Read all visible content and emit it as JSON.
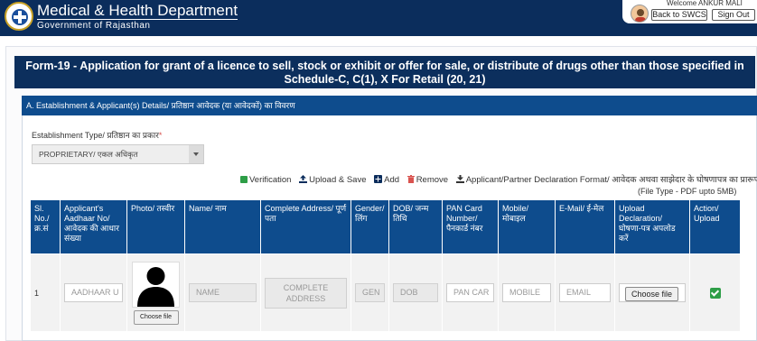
{
  "header": {
    "title": "Medical & Health Department",
    "subtitle": "Government of Rajasthan",
    "welcome": "Welcome ANKUR MALI",
    "back_label": "Back to SWCS",
    "signout_label": "Sign Out"
  },
  "form": {
    "title": "Form-19 - Application for grant of a licence to sell, stock or exhibit or offer for sale, or distribute of drugs other than those specified in Schedule-C, C(1), X For Retail (20, 21)"
  },
  "section": {
    "title": "A. Establishment & Applicant(s) Details/ प्रतिष्ठान आवेदक (या आवेदकों) का विवरण",
    "estab_label": "Establishment Type/ प्रतिष्ठान का प्रकार",
    "required_mark": "*",
    "estab_value": "PROPRIETARY/ एकल अधिकृत"
  },
  "actions": {
    "verification": "Verification",
    "upload_save": "Upload & Save",
    "add": "Add",
    "remove": "Remove",
    "declaration": "Applicant/Partner Declaration Format/ आवेदक अथवा साझेदार के घोषणापत्र का प्रारूप"
  },
  "file_type_note": "(File Type - PDF upto 5MB)",
  "table": {
    "headers": {
      "sl": "Sl. No./ क्र.सं",
      "aadhaar": "Applicant's Aadhaar No/ आवेदक की आधार संख्या",
      "photo": "Photo/ तस्वीर",
      "name": "Name/ नाम",
      "address": "Complete Address/ पूर्ण पता",
      "gender": "Gender/ लिंग",
      "dob": "DOB/ जन्म तिथि",
      "pan": "PAN Card Number/ पैनकार्ड नंबर",
      "mobile": "Mobile/ मोबाइल",
      "email": "E-Mail/ ई-मेल",
      "upload": "Upload Declaration/ घोषणा-पत्र अपलोड करें",
      "action": "Action/ Upload"
    },
    "row": {
      "sl": "1",
      "aadhaar_placeholder": "AADHAAR U",
      "photo_btn": "Choose file",
      "name_placeholder": "NAME",
      "address_placeholder": "COMPLETE ADDRESS",
      "gender_placeholder": "GEN",
      "dob_placeholder": "DOB",
      "pan_placeholder": "PAN CAR",
      "mobile_placeholder": "MOBILE",
      "email_placeholder": "EMAIL",
      "upload_btn": "Choose file"
    }
  },
  "icons": {
    "logo": "department-emblem",
    "verification": "check-square-icon",
    "upload": "upload-icon",
    "add": "plus-square-icon",
    "remove": "trash-icon",
    "download": "download-icon"
  },
  "colors": {
    "header_bg": "#0b2d5c",
    "section_bg": "#0e4c8d",
    "check_green": "#2e9e47",
    "remove_red": "#d9534f"
  }
}
